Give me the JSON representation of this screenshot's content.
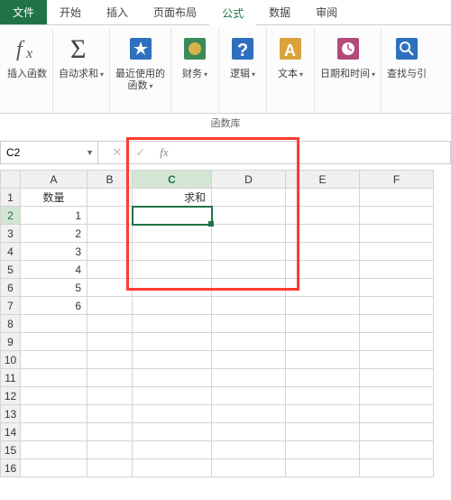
{
  "tabs": {
    "file": "文件",
    "home": "开始",
    "insert": "插入",
    "layout": "页面布局",
    "formula": "公式",
    "data": "数据",
    "review": "审阅"
  },
  "ribbon": {
    "insert_fn": "插入函数",
    "autosum": "自动求和",
    "recent": "最近使用的\n函数",
    "finance": "财务",
    "logic": "逻辑",
    "text": "文本",
    "datetime": "日期和时间",
    "lookup": "查找与引",
    "group_label": "函数库"
  },
  "namebox": {
    "value": "C2"
  },
  "fb": {
    "fx": "fx"
  },
  "columns": [
    "A",
    "B",
    "C",
    "D",
    "E",
    "F"
  ],
  "row_headers": [
    "1",
    "2",
    "3",
    "4",
    "5",
    "6",
    "7",
    "8",
    "9",
    "10",
    "11",
    "12",
    "13",
    "14",
    "15",
    "16"
  ],
  "cells": {
    "A1": "数量",
    "C1": "求和",
    "A2": "1",
    "A3": "2",
    "A4": "3",
    "A5": "4",
    "A6": "5",
    "A7": "6"
  },
  "active": "C2"
}
